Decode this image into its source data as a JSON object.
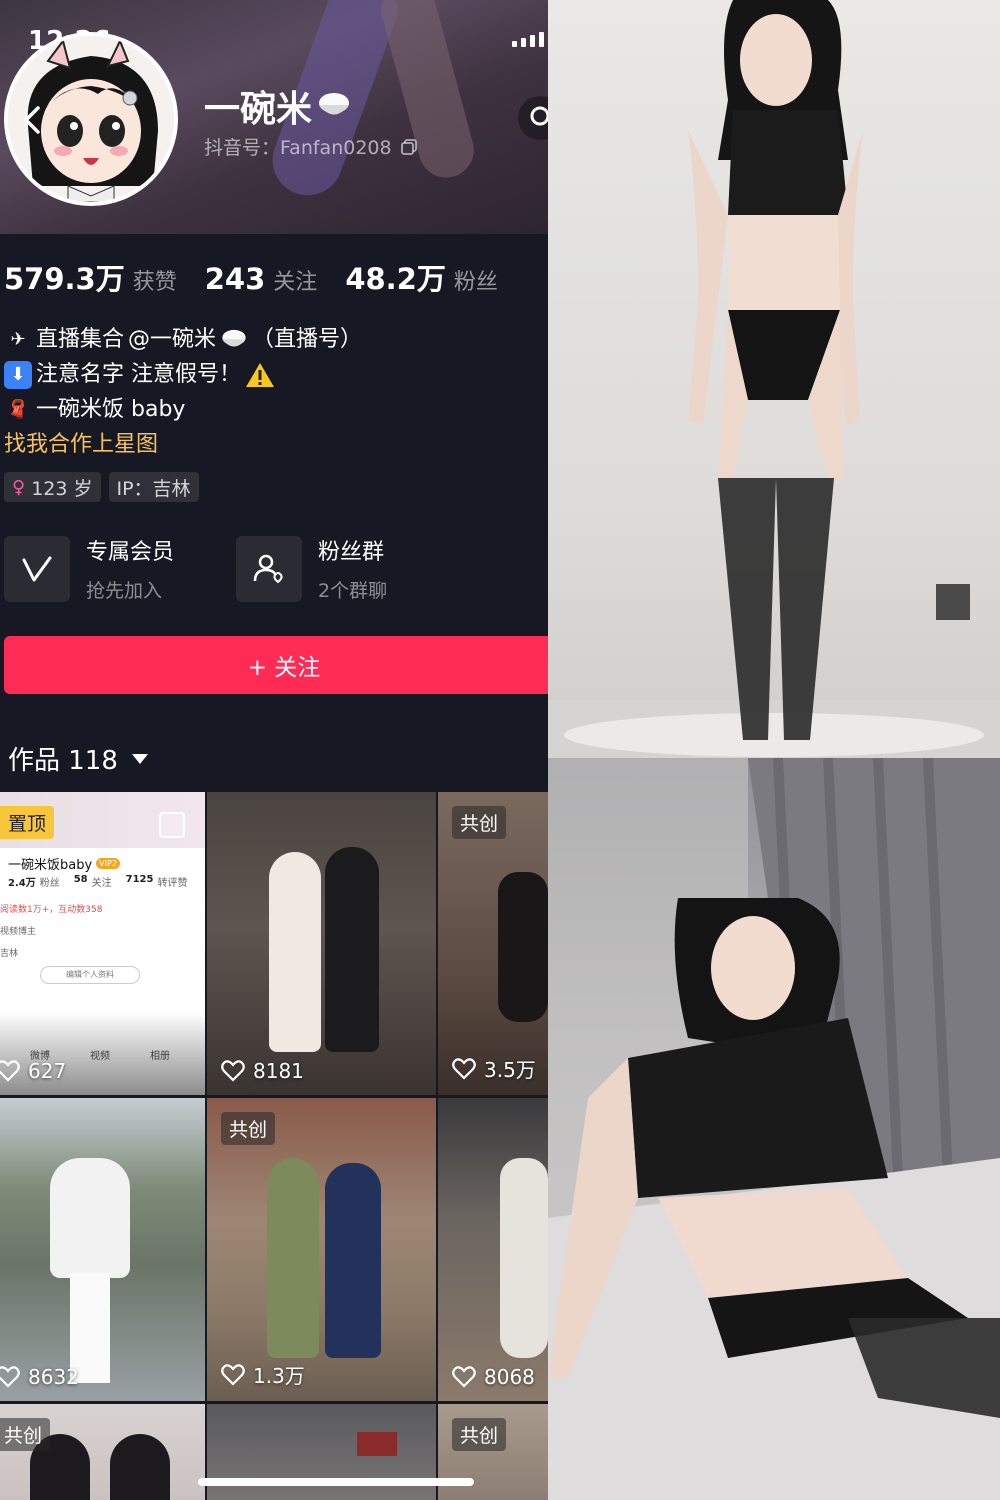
{
  "status_bar": {
    "time": "12:26"
  },
  "profile": {
    "nickname": "一碗米",
    "douyin_id": "抖音号：Fanfan0208",
    "stats": [
      {
        "num": "579.3万",
        "label": "获赞"
      },
      {
        "num": "243",
        "label": "关注"
      },
      {
        "num": "48.2万",
        "label": "粉丝"
      }
    ],
    "bio": {
      "line1_prefix": "直播集合",
      "line1_mention": "@一碗米",
      "line1_suffix": "（直播号）",
      "line2": "注意名字 注意假号！",
      "line3": "一碗米饭 baby",
      "line4": "找我合作上星图"
    },
    "tags": {
      "age": "123 岁",
      "ip": "IP：吉林"
    },
    "features": [
      {
        "title": "专属会员",
        "sub": "抢先加入"
      },
      {
        "title": "粉丝群",
        "sub": "2个群聊"
      }
    ],
    "follow_label": "+ 关注",
    "works_label": "作品 118"
  },
  "pinned_card": {
    "name": "一碗米饭baby",
    "vip": "VIP2",
    "fans_num": "2.4万",
    "fans_label": "粉丝",
    "follow_num": "58",
    "follow_label": "关注",
    "likes_num": "7125",
    "likes_label": "转评赞",
    "reads": "阅读数1万+，互动数358",
    "role": "视频博主",
    "location": "吉林",
    "edit_button": "编辑个人资料",
    "tab_weibo": "微博",
    "tab_video": "视频",
    "tab_album": "相册"
  },
  "grid": [
    {
      "likes": "627",
      "badge": "置顶"
    },
    {
      "likes": "8181",
      "badge": ""
    },
    {
      "likes": "3.5万",
      "badge": "共创"
    },
    {
      "likes": "8632",
      "badge": ""
    },
    {
      "likes": "1.3万",
      "badge": "共创"
    },
    {
      "likes": "8068",
      "badge": ""
    },
    {
      "likes": "",
      "badge": "共创"
    },
    {
      "likes": "",
      "badge": ""
    },
    {
      "likes": "",
      "badge": "共创"
    }
  ],
  "colors": {
    "follow": "#fe2c55",
    "link": "#f7c25b",
    "pinned": "#f7c63b"
  }
}
